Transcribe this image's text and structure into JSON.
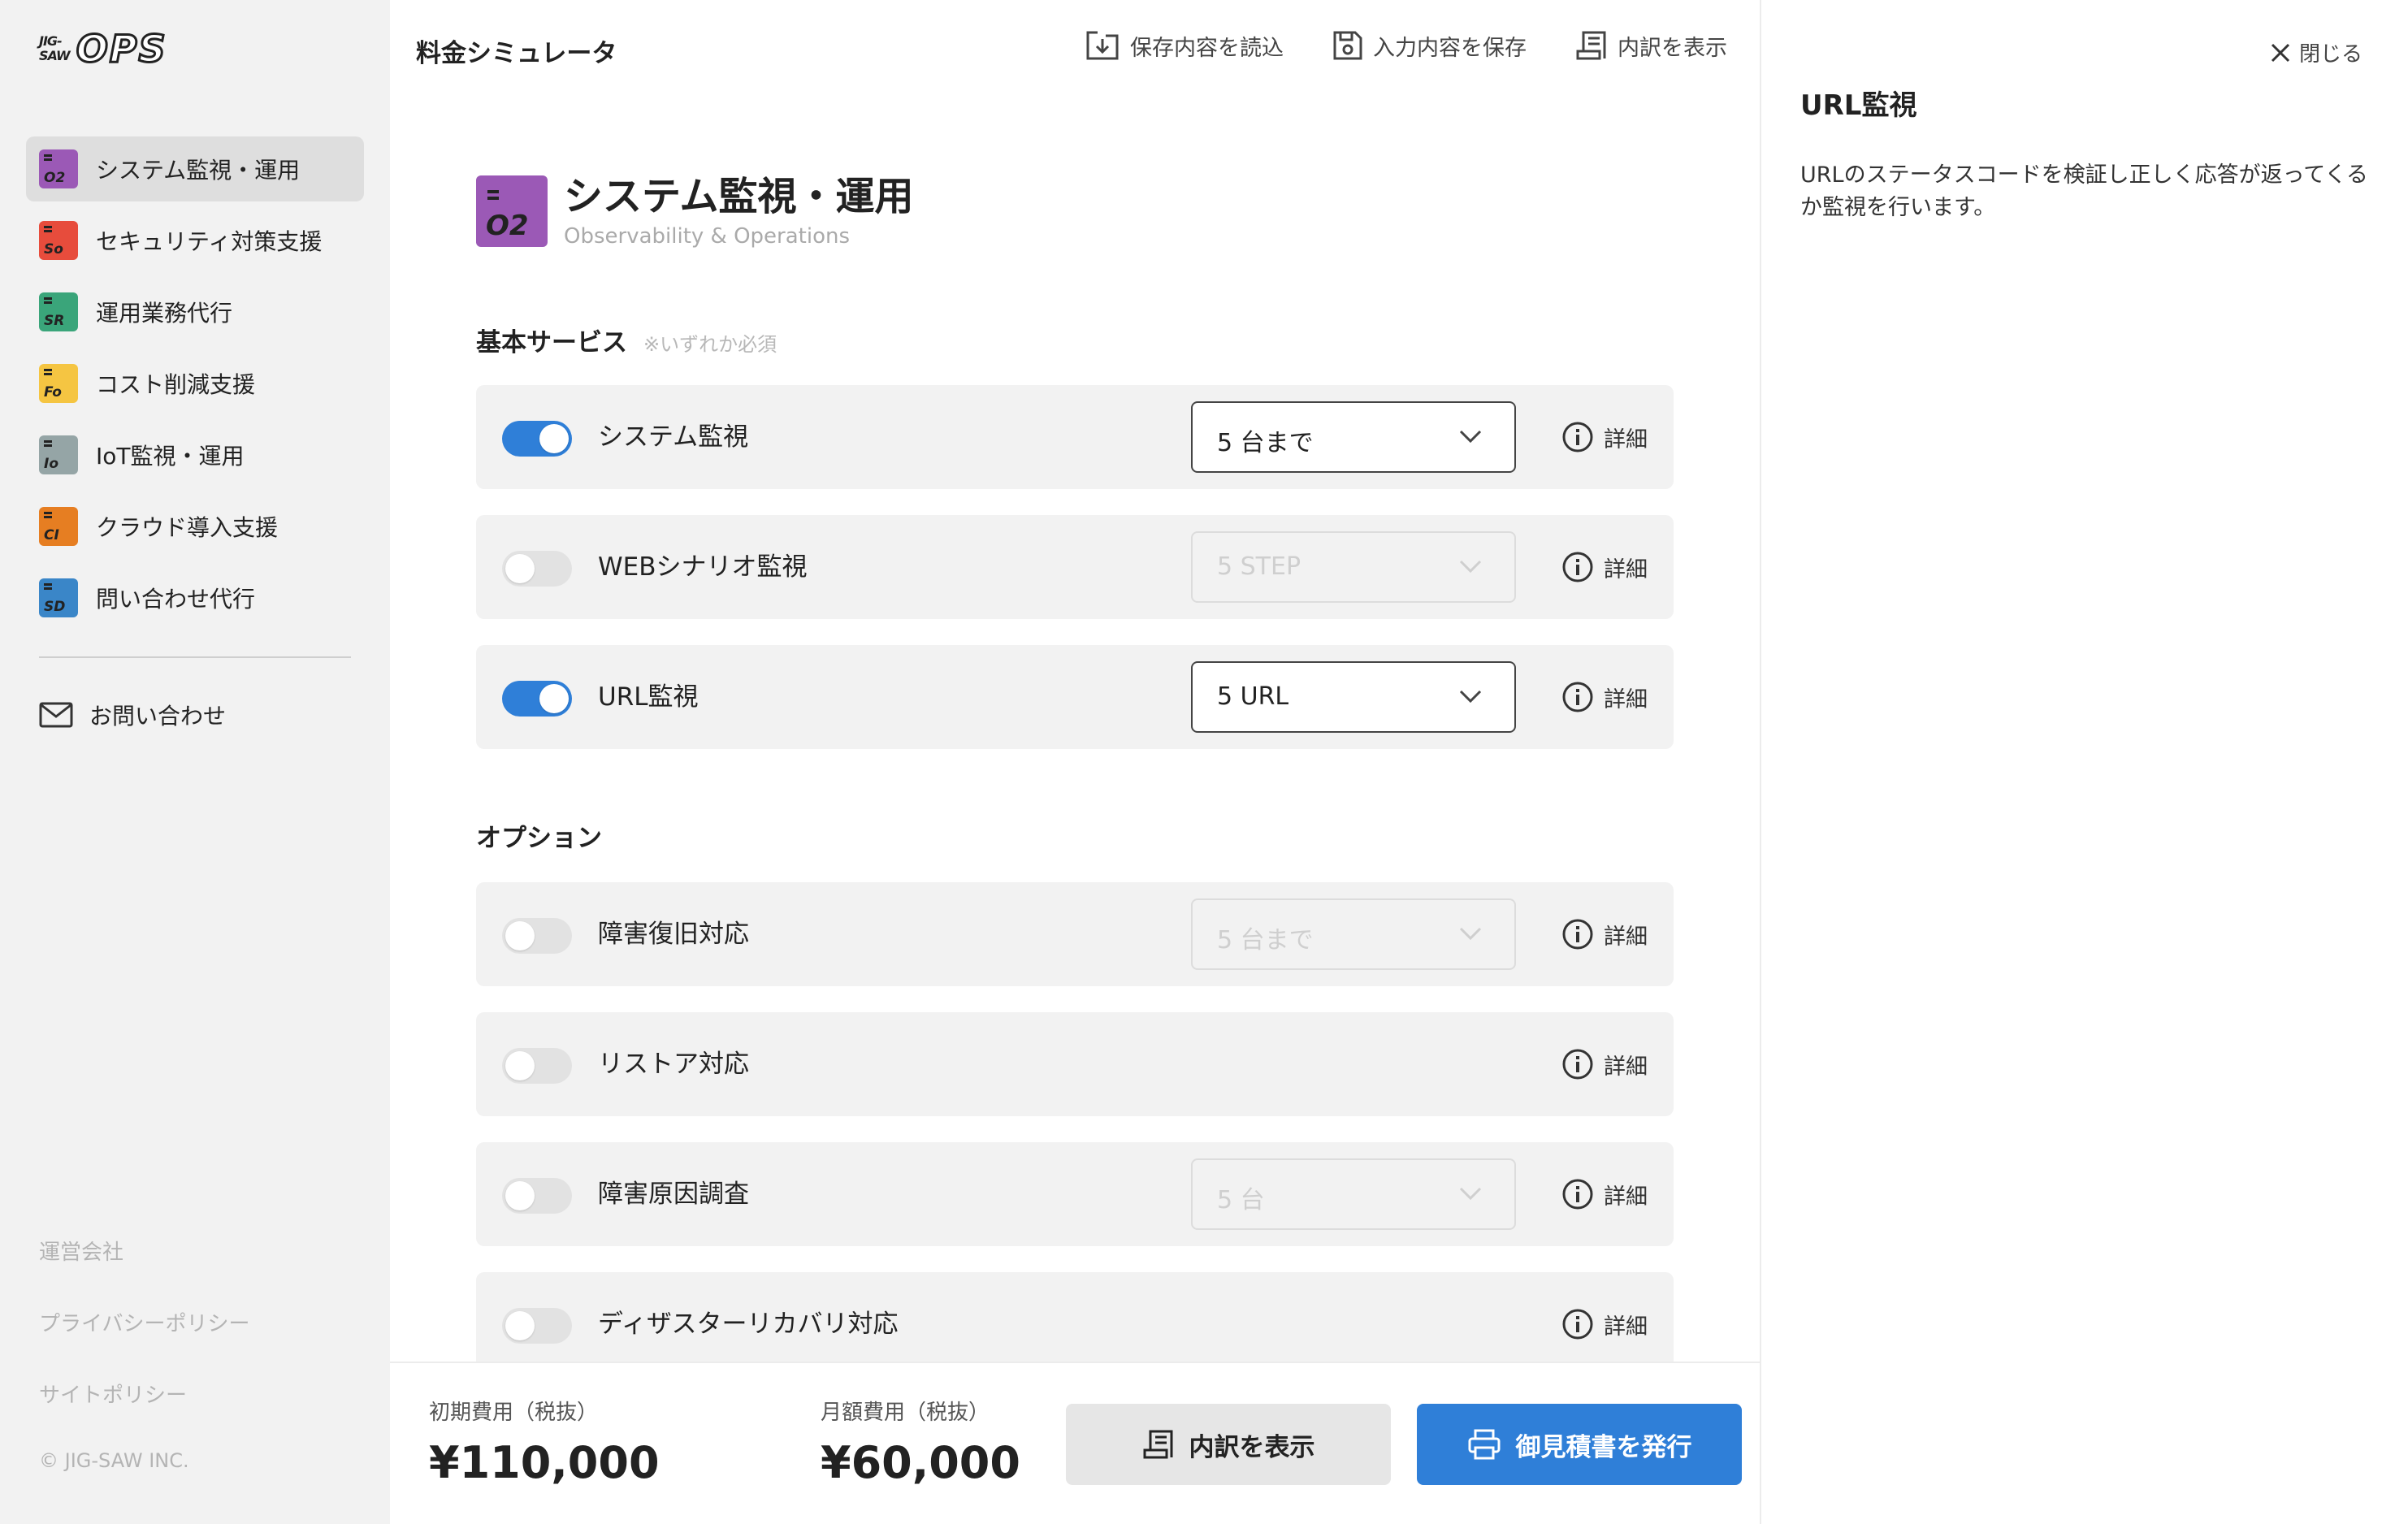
{
  "brand": {
    "small": "JIG-\nSAW",
    "name": "OPS"
  },
  "sidebar": {
    "items": [
      {
        "label": "システム監視・運用",
        "code": "O2",
        "color": "#9b59b6",
        "active": true
      },
      {
        "label": "セキュリティ対策支援",
        "code": "So",
        "color": "#e74c3c",
        "active": false
      },
      {
        "label": "運用業務代行",
        "code": "SR",
        "color": "#3aa57a",
        "active": false
      },
      {
        "label": "コスト削減支援",
        "code": "Fo",
        "color": "#f5c542",
        "active": false
      },
      {
        "label": "IoT監視・運用",
        "code": "Io",
        "color": "#95a5a6",
        "active": false
      },
      {
        "label": "クラウド導入支援",
        "code": "CI",
        "color": "#e67e22",
        "active": false
      },
      {
        "label": "問い合わせ代行",
        "code": "SD",
        "color": "#3a86c8",
        "active": false
      }
    ],
    "contact_label": "お問い合わせ",
    "footer_links": [
      "運営会社",
      "プライバシーポリシー",
      "サイトポリシー"
    ],
    "copyright": "© JIG-SAW INC."
  },
  "topbar": {
    "title": "料金シミュレータ",
    "actions": [
      "保存内容を読込",
      "入力内容を保存",
      "内訳を表示"
    ]
  },
  "section": {
    "code": "O2",
    "title": "システム監視・運用",
    "subtitle": "Observability & Operations"
  },
  "basic": {
    "title": "基本サービス",
    "note": "※いずれか必須",
    "rows": [
      {
        "label": "システム監視",
        "on": true,
        "select": "5 台まで",
        "detail": "詳細"
      },
      {
        "label": "WEBシナリオ監視",
        "on": false,
        "select": "5 STEP",
        "detail": "詳細"
      },
      {
        "label": "URL監視",
        "on": true,
        "select": "5 URL",
        "detail": "詳細"
      }
    ]
  },
  "options": {
    "title": "オプション",
    "rows": [
      {
        "label": "障害復旧対応",
        "on": false,
        "select": "5 台まで",
        "detail": "詳細"
      },
      {
        "label": "リストア対応",
        "on": false,
        "detail": "詳細"
      },
      {
        "label": "障害原因調査",
        "on": false,
        "select": "5 台",
        "detail": "詳細"
      },
      {
        "label": "ディザスターリカバリ対応",
        "on": false,
        "detail": "詳細"
      }
    ]
  },
  "bottom": {
    "initial_label": "初期費用（税抜）",
    "initial_value": "¥110,000",
    "monthly_label": "月額費用（税抜）",
    "monthly_value": "¥60,000",
    "breakdown_button": "内訳を表示",
    "quote_button": "御見積書を発行"
  },
  "panel": {
    "close_label": "閉じる",
    "title": "URL監視",
    "description": "URLのステータスコードを検証し正しく応答が返ってくるか監視を行います。"
  },
  "colors": {
    "accent": "#2f7fd8",
    "sidebar_bg": "#f2f2f2",
    "row_bg": "#f2f2f2"
  }
}
